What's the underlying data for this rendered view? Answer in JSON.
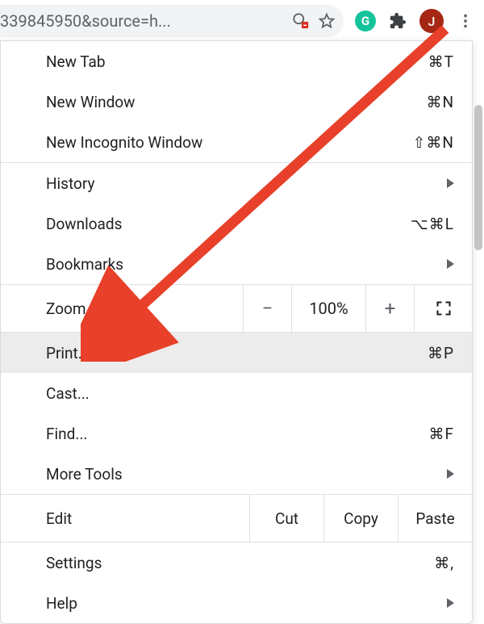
{
  "toolbar": {
    "url_fragment": "339845950&source=h...",
    "avatar_letter": "J",
    "grammarly_letter": "G"
  },
  "menu": {
    "new_tab": {
      "label": "New Tab",
      "shortcut": "⌘T"
    },
    "new_window": {
      "label": "New Window",
      "shortcut": "⌘N"
    },
    "incognito": {
      "label": "New Incognito Window",
      "shortcut": "⇧⌘N"
    },
    "history": {
      "label": "History"
    },
    "downloads": {
      "label": "Downloads",
      "shortcut": "⌥⌘L"
    },
    "bookmarks": {
      "label": "Bookmarks"
    },
    "zoom": {
      "label": "Zoom",
      "value": "100%"
    },
    "print": {
      "label": "Print...",
      "shortcut": "⌘P"
    },
    "cast": {
      "label": "Cast..."
    },
    "find": {
      "label": "Find...",
      "shortcut": "⌘F"
    },
    "more_tools": {
      "label": "More Tools"
    },
    "edit": {
      "label": "Edit",
      "cut": "Cut",
      "copy": "Copy",
      "paste": "Paste"
    },
    "settings": {
      "label": "Settings",
      "shortcut": "⌘,"
    },
    "help": {
      "label": "Help"
    }
  }
}
